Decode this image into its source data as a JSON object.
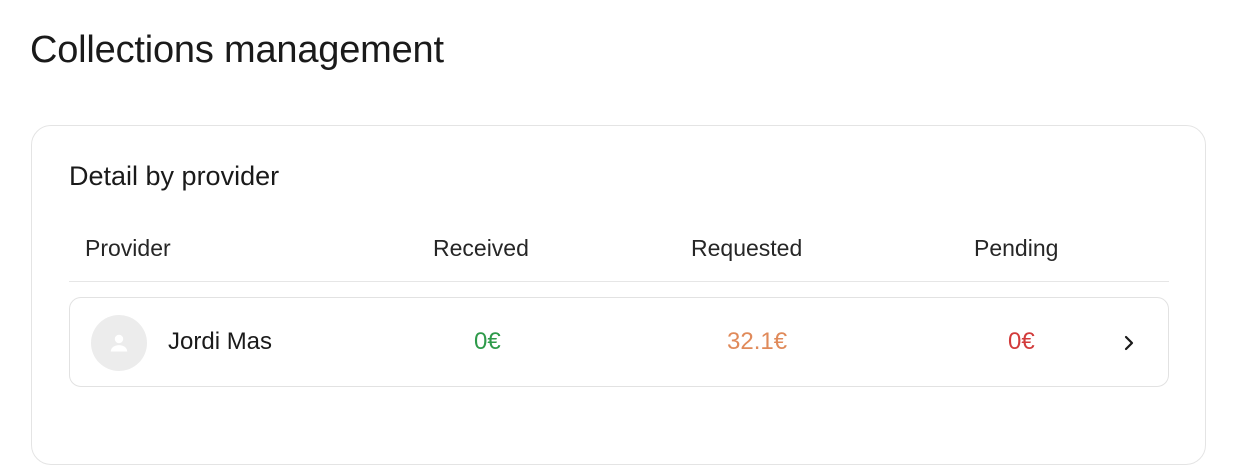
{
  "page": {
    "title": "Collections management"
  },
  "card": {
    "title": "Detail by provider"
  },
  "table": {
    "columns": {
      "provider": "Provider",
      "received": "Received",
      "requested": "Requested",
      "pending": "Pending"
    },
    "rows": [
      {
        "avatar_icon": "person-icon",
        "provider": "Jordi Mas",
        "received": "0€",
        "requested": "32.1€",
        "pending": "0€",
        "action_icon": "chevron-right-icon"
      }
    ]
  },
  "colors": {
    "received": "#2e9a4a",
    "requested": "#e08a5a",
    "pending": "#d23b3b",
    "avatar_bg": "#ececec",
    "avatar_icon": "#ffffff",
    "border": "#e4e4e4"
  }
}
